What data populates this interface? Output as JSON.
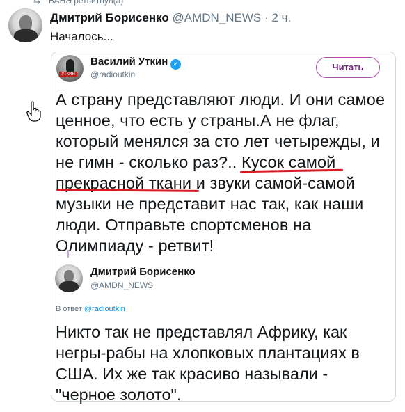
{
  "retweet_header": {
    "text": "ВАНЭ ретвитнул(а)"
  },
  "tweet": {
    "author_name": "Дмитрий Борисенко",
    "author_handle": "@AMDN_NEWS",
    "separator": "·",
    "time": "2 ч.",
    "text": "Началось..."
  },
  "quoted": {
    "author_name": "Василий Уткин",
    "author_handle": "@radioutkin",
    "follow_label": "Читать",
    "verified_glyph": "✓",
    "text_lines": [
      "А страну представляют люди. И они самое",
      "ценное, что есть у страны.А не флаг,",
      "который менялся за сто лет четырежды, и",
      "не гимн - сколько раз?.. Кусок самой",
      "прекрасной ткани и звуки самой-самой",
      "музыки не представит нас так, как наши",
      "люди. Отправьте спортсменов на",
      "Олимпиаду - ретвит!"
    ]
  },
  "reply": {
    "author_name": "Дмитрий Борисенко",
    "author_handle": "@AMDN_NEWS",
    "reply_prefix": "В ответ",
    "reply_mention": "@radioutkin",
    "text_lines": [
      "Никто так не представлял Африку, как",
      "негры-рабы на хлопковых плантациях в",
      "США. Их же так красиво называли -",
      "\"черное золото\"."
    ]
  },
  "colors": {
    "link_blue": "#1b95e0",
    "verified_blue": "#1da1f2",
    "secondary_text": "#657786",
    "underline_red": "#d81b24",
    "follow_border": "#b04db3"
  },
  "icons": {
    "retweet": "retweet-icon",
    "verified": "verified-badge-icon",
    "cursor": "hand-pointer-icon"
  }
}
